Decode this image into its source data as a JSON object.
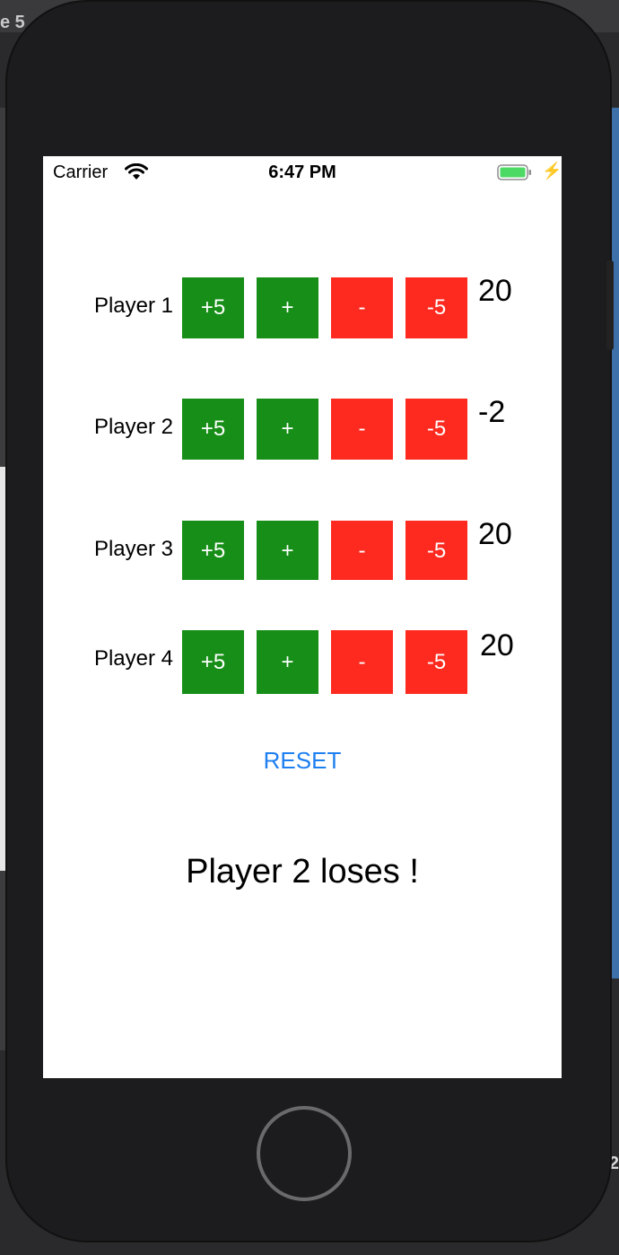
{
  "backdrop": {
    "tab_text": "e 5",
    "corner_text": "2"
  },
  "status_bar": {
    "carrier": "Carrier",
    "time": "6:47 PM",
    "wifi_icon": "wifi-icon",
    "battery_icon": "battery-icon",
    "charging_icon": "⚡"
  },
  "players": [
    {
      "label": "Player 1",
      "score": "20",
      "plus5": "+5",
      "plus1": "+",
      "minus1": "-",
      "minus5": "-5"
    },
    {
      "label": "Player 2",
      "score": "-2",
      "plus5": "+5",
      "plus1": "+",
      "minus1": "-",
      "minus5": "-5"
    },
    {
      "label": "Player 3",
      "score": "20",
      "plus5": "+5",
      "plus1": "+",
      "minus1": "-",
      "minus5": "-5"
    },
    {
      "label": "Player 4",
      "score": "20",
      "plus5": "+5",
      "plus1": "+",
      "minus1": "-",
      "minus5": "-5"
    }
  ],
  "reset_label": "RESET",
  "message": "Player 2 loses !",
  "colors": {
    "increment": "#168e17",
    "decrement": "#fe2a1f",
    "link": "#1d7ff0",
    "battery": "#4cd964"
  }
}
